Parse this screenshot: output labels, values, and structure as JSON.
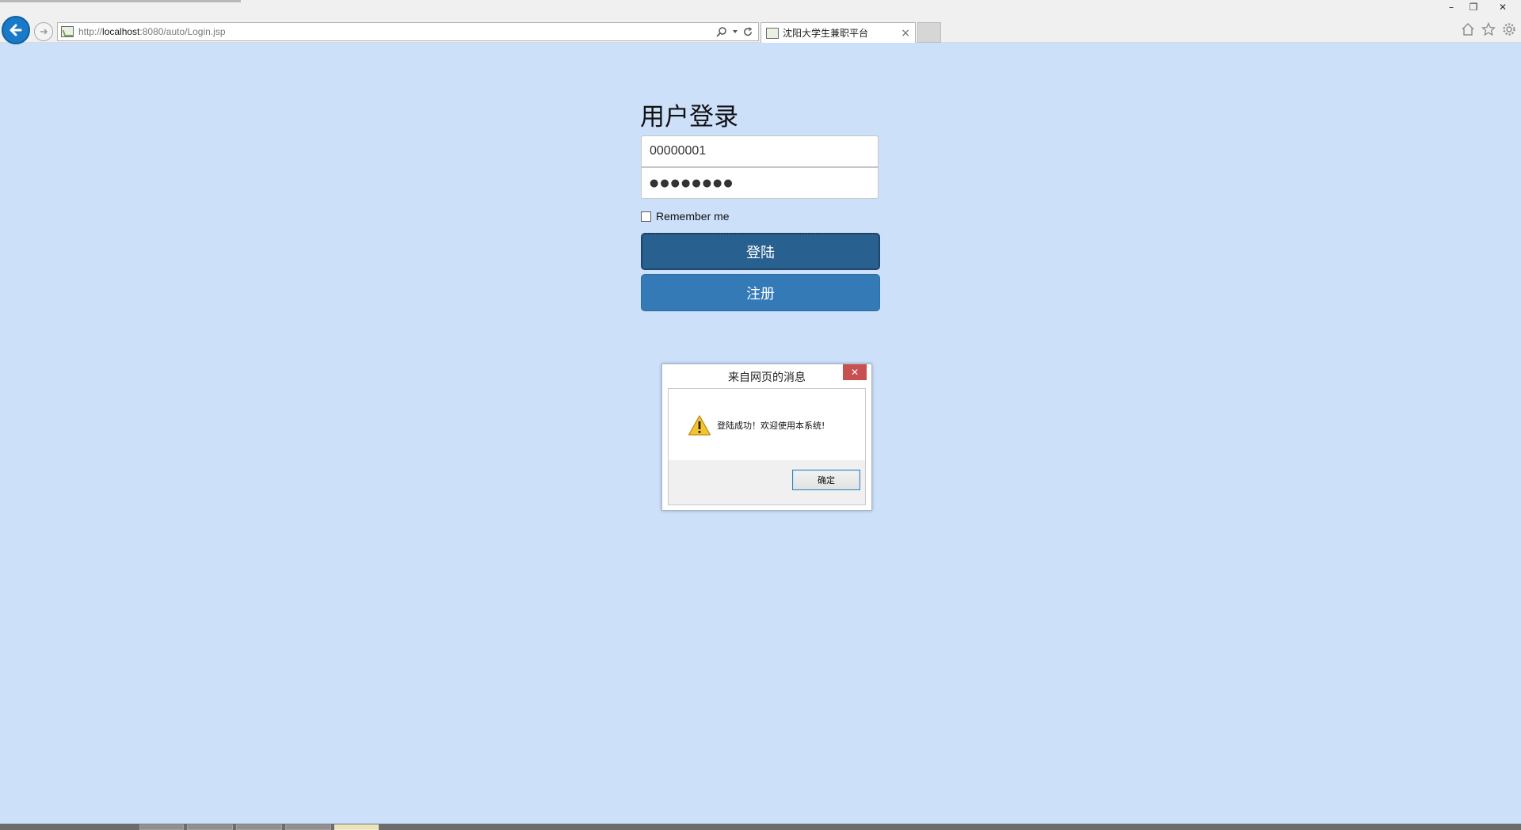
{
  "browser": {
    "url_prefix": "http://",
    "url_host": "localhost",
    "url_rest": ":8080/auto/Login.jsp",
    "tab_title": "沈阳大学生兼职平台",
    "tab_close": "×",
    "window_controls": {
      "minimize": "–",
      "restore": "❐",
      "close": "✕"
    },
    "icons": [
      "home-icon",
      "favorites-star-icon",
      "settings-gear-icon"
    ]
  },
  "login": {
    "title": "用户登录",
    "username_value": "00000001",
    "password_display": "●●●●●●●●",
    "remember_label": "Remember me",
    "remember_checked": false,
    "login_button": "登陆",
    "register_button": "注册"
  },
  "dialog": {
    "title": "来自网页的消息",
    "close": "✕",
    "message": "登陆成功！欢迎使用本系统!",
    "ok_button": "确定",
    "icon": "warning-icon"
  },
  "colors": {
    "page_background": "#cce0fa",
    "login_button": "#28608f",
    "register_button": "#337ab7",
    "dialog_close": "#c75050"
  }
}
